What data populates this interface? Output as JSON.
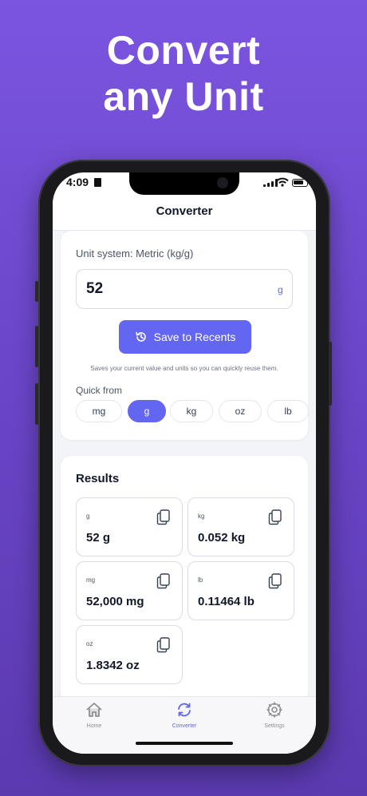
{
  "promo": {
    "line1": "Convert",
    "line2": "any Unit"
  },
  "status_bar": {
    "time": "4:09"
  },
  "nav": {
    "title": "Converter"
  },
  "converter": {
    "unit_system_label": "Unit system: Metric (kg/g)",
    "input_value": "52",
    "input_unit": "g",
    "save_button_label": "Save to Recents",
    "hint": "Saves your current value and units so you can quickly reuse them.",
    "quick_from_label": "Quick from",
    "quick_units": [
      {
        "label": "mg",
        "selected": false
      },
      {
        "label": "g",
        "selected": true
      },
      {
        "label": "kg",
        "selected": false
      },
      {
        "label": "oz",
        "selected": false
      },
      {
        "label": "lb",
        "selected": false
      }
    ]
  },
  "results": {
    "title": "Results",
    "items": [
      {
        "unit": "g",
        "value": "52 g"
      },
      {
        "unit": "kg",
        "value": "0.052 kg"
      },
      {
        "unit": "mg",
        "value": "52,000 mg"
      },
      {
        "unit": "lb",
        "value": "0.11464 lb"
      },
      {
        "unit": "oz",
        "value": "1.8342 oz"
      }
    ]
  },
  "tabs": [
    {
      "label": "Home",
      "icon": "house-icon",
      "active": false
    },
    {
      "label": "Converter",
      "icon": "refresh-arrows-icon",
      "active": true
    },
    {
      "label": "Settings",
      "icon": "gear-icon",
      "active": false
    }
  ],
  "colors": {
    "accent": "#6366f1",
    "background_gradient_top": "#7b55e0",
    "background_gradient_bottom": "#5b3ab0"
  }
}
